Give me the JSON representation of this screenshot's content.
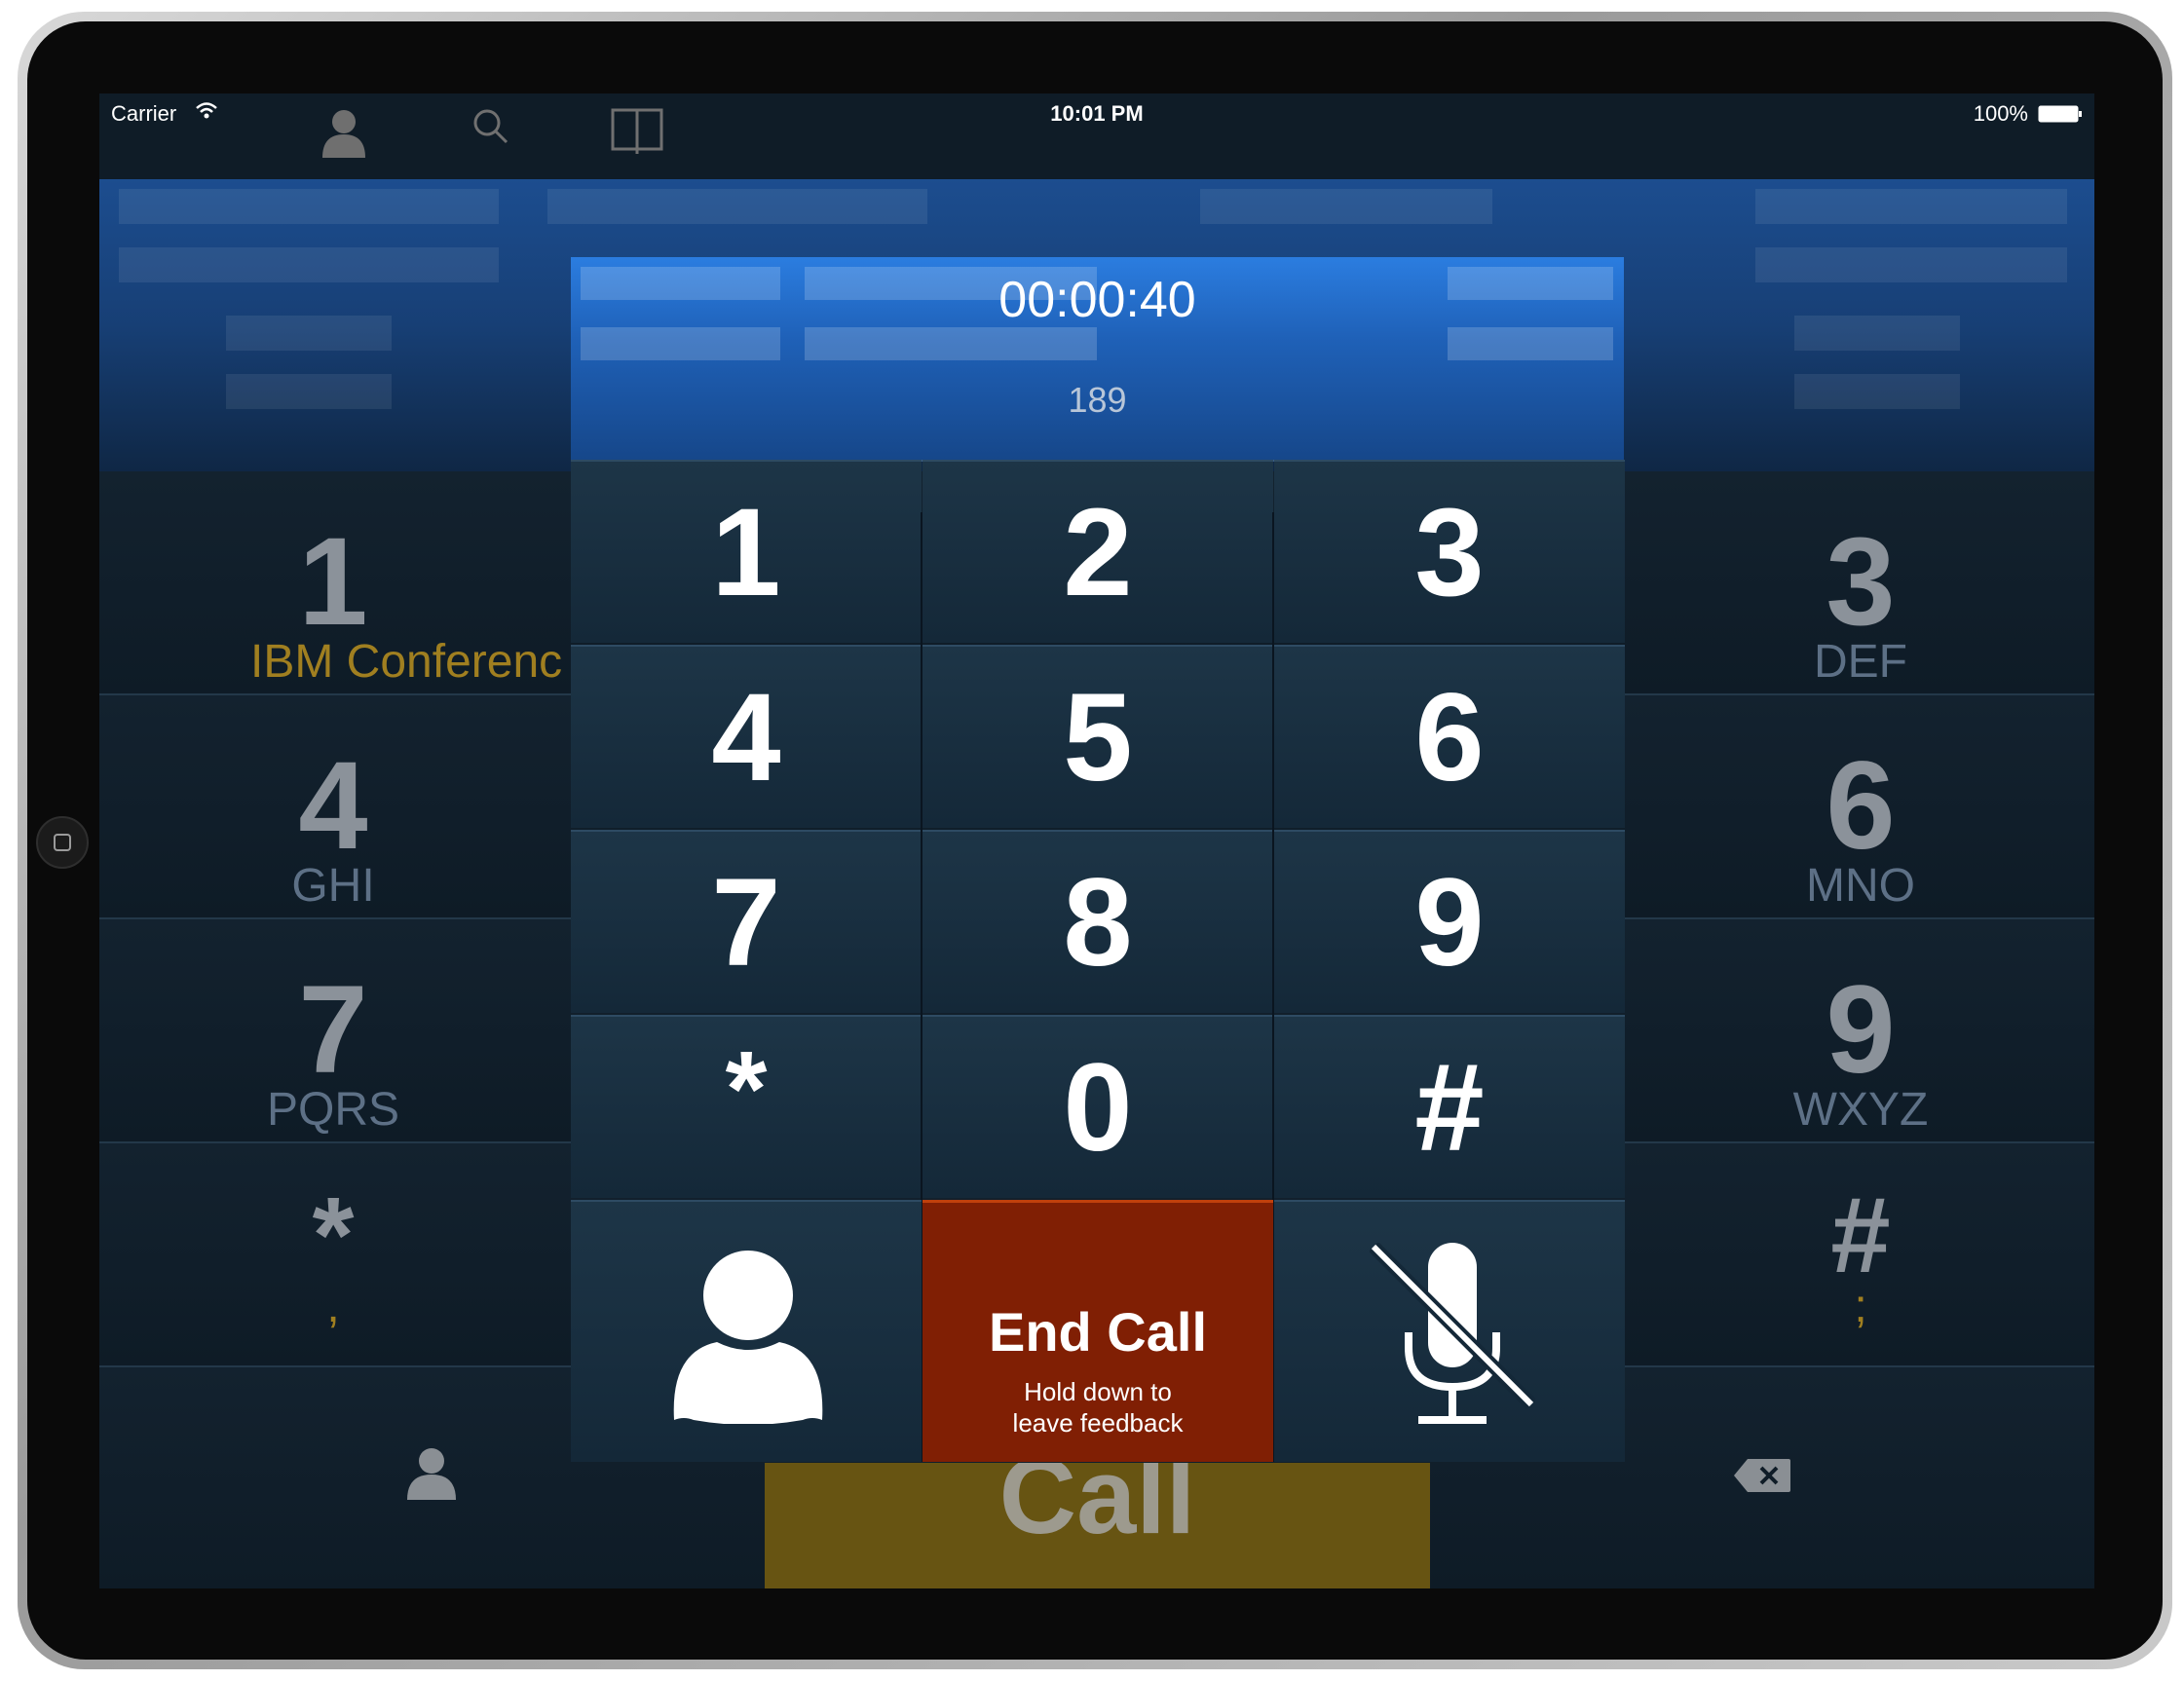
{
  "status_bar": {
    "carrier": "Carrier",
    "time": "10:01 PM",
    "battery": "100%"
  },
  "toolbar": {
    "icons": [
      "person-icon",
      "search-icon",
      "book-icon"
    ]
  },
  "background_dialer": {
    "keys": [
      {
        "digit": "1",
        "letters": "IBM Conferenc"
      },
      {
        "digit": "3",
        "letters": "DEF"
      },
      {
        "digit": "4",
        "letters": "GHI"
      },
      {
        "digit": "6",
        "letters": "MNO"
      },
      {
        "digit": "7",
        "letters": "PQRS"
      },
      {
        "digit": "9",
        "letters": "WXYZ"
      },
      {
        "digit": "*",
        "letters": ","
      },
      {
        "digit": "#",
        "letters": ";"
      }
    ],
    "call_label": "Call"
  },
  "in_call": {
    "timer": "00:00:40",
    "number": "189",
    "keypad": [
      "1",
      "2",
      "3",
      "4",
      "5",
      "6",
      "7",
      "8",
      "9",
      "*",
      "0",
      "#"
    ],
    "end_call_label": "End Call",
    "end_call_hint_line1": "Hold down to",
    "end_call_hint_line2": "leave feedback"
  },
  "colors": {
    "end_call": "#801f04",
    "banner_blue": "#2b7de0",
    "gold_label": "#a07f20",
    "call_button": "#675412"
  }
}
